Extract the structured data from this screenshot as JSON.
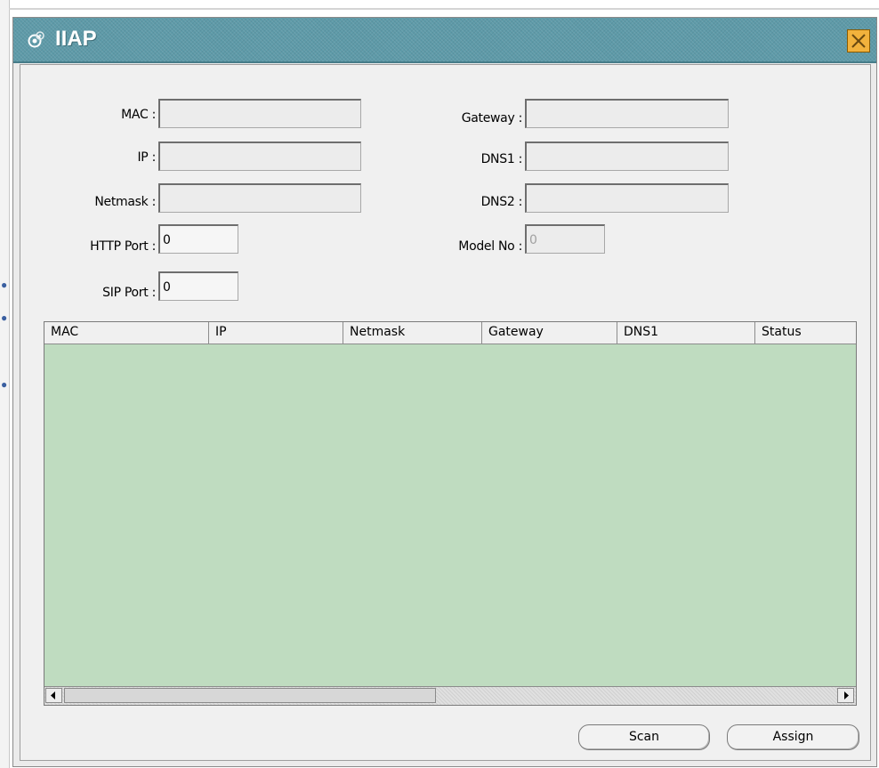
{
  "window": {
    "title": "IIAP",
    "icon": "gear-icon",
    "close_icon": "close-icon",
    "accent": "#5e9aa8",
    "close_color": "#f2b23c"
  },
  "form": {
    "mac_label": "MAC :",
    "mac_value": "",
    "ip_label": "IP :",
    "ip_value": "",
    "netmask_label": "Netmask :",
    "netmask_value": "",
    "http_port_label": "HTTP Port :",
    "http_port_value": "0",
    "sip_port_label": "SIP Port :",
    "sip_port_value": "0",
    "gateway_label": "Gateway :",
    "gateway_value": "",
    "dns1_label": "DNS1 :",
    "dns1_value": "",
    "dns2_label": "DNS2 :",
    "dns2_value": "",
    "model_no_label": "Model No :",
    "model_no_value": "0"
  },
  "table": {
    "columns": [
      "MAC",
      "IP",
      "Netmask",
      "Gateway",
      "DNS1",
      "Status"
    ],
    "rows": [],
    "background": "#bfdcc0"
  },
  "buttons": {
    "scan": "Scan",
    "assign": "Assign"
  }
}
